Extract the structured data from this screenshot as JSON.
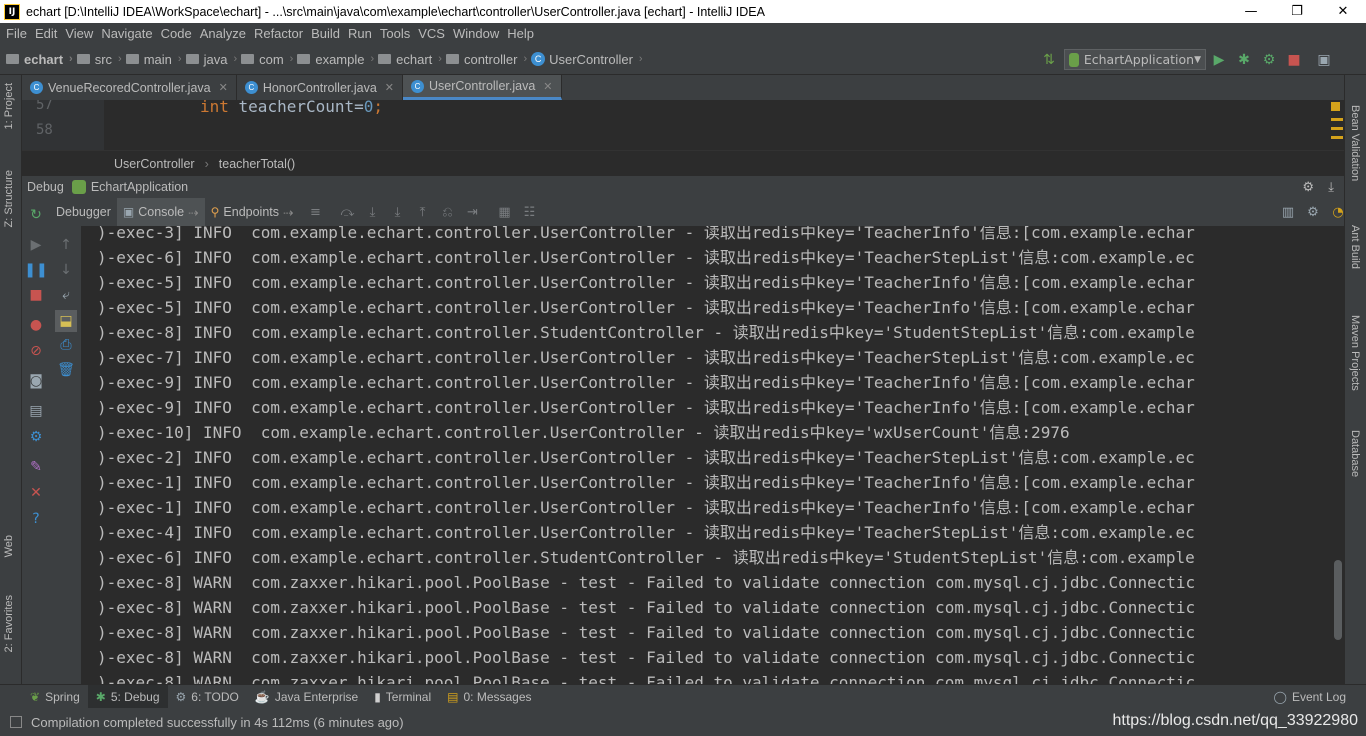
{
  "window": {
    "title": "echart [D:\\IntelliJ IDEA\\WorkSpace\\echart] - ...\\src\\main\\java\\com\\example\\echart\\controller\\UserController.java [echart] - IntelliJ IDEA",
    "minimize": "—",
    "restore": "❐",
    "close": "✕"
  },
  "menu": [
    "File",
    "Edit",
    "View",
    "Navigate",
    "Code",
    "Analyze",
    "Refactor",
    "Build",
    "Run",
    "Tools",
    "VCS",
    "Window",
    "Help"
  ],
  "breadcrumbs": [
    "echart",
    "src",
    "main",
    "java",
    "com",
    "example",
    "echart",
    "controller",
    "UserController"
  ],
  "run_config": "EchartApplication",
  "left_tabs": [
    "1: Project",
    "Z: Structure",
    "Web",
    "2: Favorites"
  ],
  "right_tabs": [
    "Bean Validation",
    "Ant Build",
    "Maven Projects",
    "Database"
  ],
  "editor_tabs": [
    {
      "label": "VenueRecoredController.java"
    },
    {
      "label": "HonorController.java"
    },
    {
      "label": "UserController.java"
    }
  ],
  "editor": {
    "lines": [
      {
        "no": "57",
        "kw": "int",
        "text": " teacherCount=",
        "num": "0",
        "end": ";"
      },
      {
        "no": "58",
        "kw": "",
        "text": "",
        "num": "",
        "end": ""
      }
    ],
    "breadcrumb_class": "UserController",
    "breadcrumb_method": "teacherTotal()"
  },
  "debug": {
    "label": "Debug",
    "config": "EchartApplication",
    "tabs": [
      "Debugger",
      "Console",
      "Endpoints"
    ]
  },
  "console_lines": [
    ")-exec-3] INFO  com.example.echart.controller.UserController - 读取出redis中key='TeacherInfo'信息:[com.example.echar",
    ")-exec-6] INFO  com.example.echart.controller.UserController - 读取出redis中key='TeacherStepList'信息:com.example.ec",
    ")-exec-5] INFO  com.example.echart.controller.UserController - 读取出redis中key='TeacherInfo'信息:[com.example.echar",
    ")-exec-5] INFO  com.example.echart.controller.UserController - 读取出redis中key='TeacherInfo'信息:[com.example.echar",
    ")-exec-8] INFO  com.example.echart.controller.StudentController - 读取出redis中key='StudentStepList'信息:com.example",
    ")-exec-7] INFO  com.example.echart.controller.UserController - 读取出redis中key='TeacherStepList'信息:com.example.ec",
    ")-exec-9] INFO  com.example.echart.controller.UserController - 读取出redis中key='TeacherInfo'信息:[com.example.echar",
    ")-exec-9] INFO  com.example.echart.controller.UserController - 读取出redis中key='TeacherInfo'信息:[com.example.echar",
    ")-exec-10] INFO  com.example.echart.controller.UserController - 读取出redis中key='wxUserCount'信息:2976",
    ")-exec-2] INFO  com.example.echart.controller.UserController - 读取出redis中key='TeacherStepList'信息:com.example.ec",
    ")-exec-1] INFO  com.example.echart.controller.UserController - 读取出redis中key='TeacherInfo'信息:[com.example.echar",
    ")-exec-1] INFO  com.example.echart.controller.UserController - 读取出redis中key='TeacherInfo'信息:[com.example.echar",
    ")-exec-4] INFO  com.example.echart.controller.UserController - 读取出redis中key='TeacherStepList'信息:com.example.ec",
    ")-exec-6] INFO  com.example.echart.controller.StudentController - 读取出redis中key='StudentStepList'信息:com.example",
    ")-exec-8] WARN  com.zaxxer.hikari.pool.PoolBase - test - Failed to validate connection com.mysql.cj.jdbc.Connectic",
    ")-exec-8] WARN  com.zaxxer.hikari.pool.PoolBase - test - Failed to validate connection com.mysql.cj.jdbc.Connectic",
    ")-exec-8] WARN  com.zaxxer.hikari.pool.PoolBase - test - Failed to validate connection com.mysql.cj.jdbc.Connectic",
    ")-exec-8] WARN  com.zaxxer.hikari.pool.PoolBase - test - Failed to validate connection com.mysql.cj.jdbc.Connectic",
    ")-exec-8] WARN  com.zaxxer.hikari.pool.PoolBase - test - Failed to validate connection com.mysql.cj.jdbc.Connectic"
  ],
  "bottom_tabs": [
    "Spring",
    "5: Debug",
    "6: TODO",
    "Java Enterprise",
    "Terminal",
    "0: Messages"
  ],
  "event_log": "Event Log",
  "status": {
    "message": "Compilation completed successfully in 4s 112ms (6 minutes ago)",
    "watermark": "https://blog.csdn.net/qq_33922980"
  },
  "colors": {
    "background": "#2b2b2b",
    "panel": "#3c3f41",
    "keyword": "#cc7832",
    "number": "#6897bb",
    "accent": "#4a88c7"
  }
}
